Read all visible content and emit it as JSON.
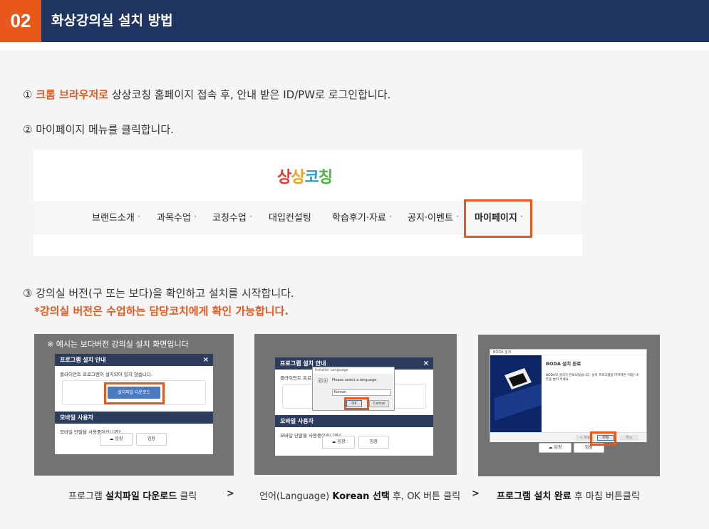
{
  "header": {
    "number": "02",
    "title": "화상강의실 설치 방법"
  },
  "steps": {
    "s1_marker": "①",
    "s1_highlight": "크롬 브라우저로",
    "s1_text": "상상코칭 홈페이지 접속 후, 안내 받은 ID/PW로 로그인합니다.",
    "s2": "② 마이페이지 메뉴를 클릭합니다.",
    "s3": "③ 강의실 버전(구 또는 보다)을 확인하고 설치를 시작합니다.",
    "s3_note": "*강의실 버전은 수업하는 담당코치에게 확인 가능합니다."
  },
  "site": {
    "logo": [
      "상",
      "상",
      "코",
      "칭"
    ],
    "nav": [
      {
        "label": "브랜드소개",
        "caret": "˅"
      },
      {
        "label": "과목수업",
        "caret": "˅"
      },
      {
        "label": "코칭수업",
        "caret": "˅"
      },
      {
        "label": "대입컨설팅",
        "caret": ""
      },
      {
        "label": "학습후기·자료",
        "caret": "˅"
      },
      {
        "label": "공지·이벤트",
        "caret": "˅"
      },
      {
        "label": "마이페이지",
        "caret": "˅"
      }
    ]
  },
  "shot1": {
    "caption": "※ 예시는 보다버전 강의실 설치 화면입니다",
    "title": "프로그램 설치 안내",
    "close": "×",
    "text": "클라이언트 프로그램이 설치되어 있지 않습니다.",
    "download": "설치파일 다운로드",
    "mobile_title": "모바일 사용자",
    "mobile_text": "모바일 단말을 사용중이십니까?",
    "btn_android": "☁ 입장",
    "btn_ios": " 입장"
  },
  "shot2": {
    "title": "프로그램 설치 안내",
    "close": "×",
    "text": "클라이언트 프로그",
    "mobile_title": "모바일 사용자",
    "mobile_text": "모바일 단말을 사용중이십니까?",
    "btn_android": "☁ 입장",
    "btn_ios": " 입장",
    "lang_title": "Installer Language",
    "lang_icon": "ⓓⓐ",
    "lang_prompt": "Please select a language.",
    "lang_value": "Korean",
    "ok": "OK",
    "cancel": "Cancel"
  },
  "shot3": {
    "window_title": "BODA 설치",
    "heading": "BODA 설치 완료",
    "body": "BODA의 설치가 완료되었습니다. 설치 프로그램을 마치려면 '마침' 버튼을 눌러 주세요.",
    "back": "< 뒤로",
    "finish": "마침",
    "cancel": "취소",
    "btn_android": "☁ 입장",
    "btn_ios": " 입장"
  },
  "captions": {
    "c1_pre": "프로그램 ",
    "c1_bold": "설치파일 다운로드",
    "c1_post": " 클릭",
    "c2_pre": "언어(Language) ",
    "c2_bold": "Korean  선택",
    "c2_post": " 후, OK 버튼 클릭",
    "c3_bold": "프로그램 설치 완료",
    "c3_post": " 후 마침 버튼클릭",
    "arrow": ">"
  },
  "colors": {
    "navy": "#1e3461",
    "orange": "#e8581c",
    "gray_bg": "#737373"
  }
}
